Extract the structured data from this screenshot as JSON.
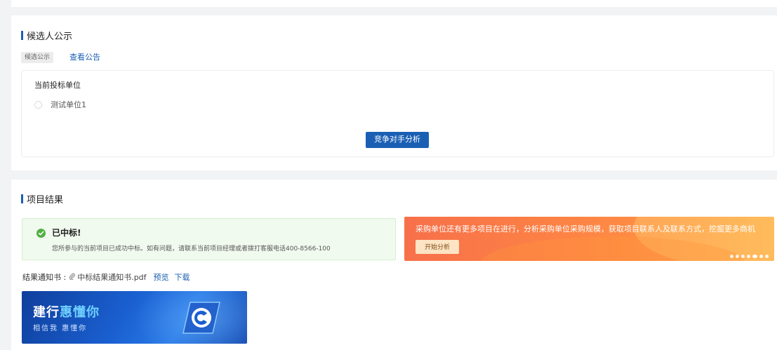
{
  "candidate_section": {
    "title": "候选人公示",
    "tag": "候选公示",
    "view_link": "查看公告",
    "current_bidders_title": "当前投标单位",
    "bidders": [
      "测试单位1"
    ],
    "analyze_button": "竞争对手分析"
  },
  "result_section": {
    "title": "项目结果",
    "win_title": "已中标!",
    "win_desc": "您所参与的当前项目已成功中标。如有问题，请联系当前项目经理或者拨打客服电话400-8566-100",
    "promo_text": "采购单位还有更多项目在进行，分析采购单位采购规模，获取项目联系人及联系方式，挖掘更多商机",
    "promo_button": "开始分析",
    "notice_label": "结果通知书 :",
    "notice_file": "中标结果通知书.pdf",
    "preview_link": "预览",
    "download_link": "下载",
    "banner_title_part1": "建行",
    "banner_title_highlight": "惠懂你",
    "banner_subtitle": "相信我  惠懂你"
  },
  "colors": {
    "primary": "#1a5fb4",
    "success": "#52b043",
    "promo_orange": "#f7704a"
  }
}
